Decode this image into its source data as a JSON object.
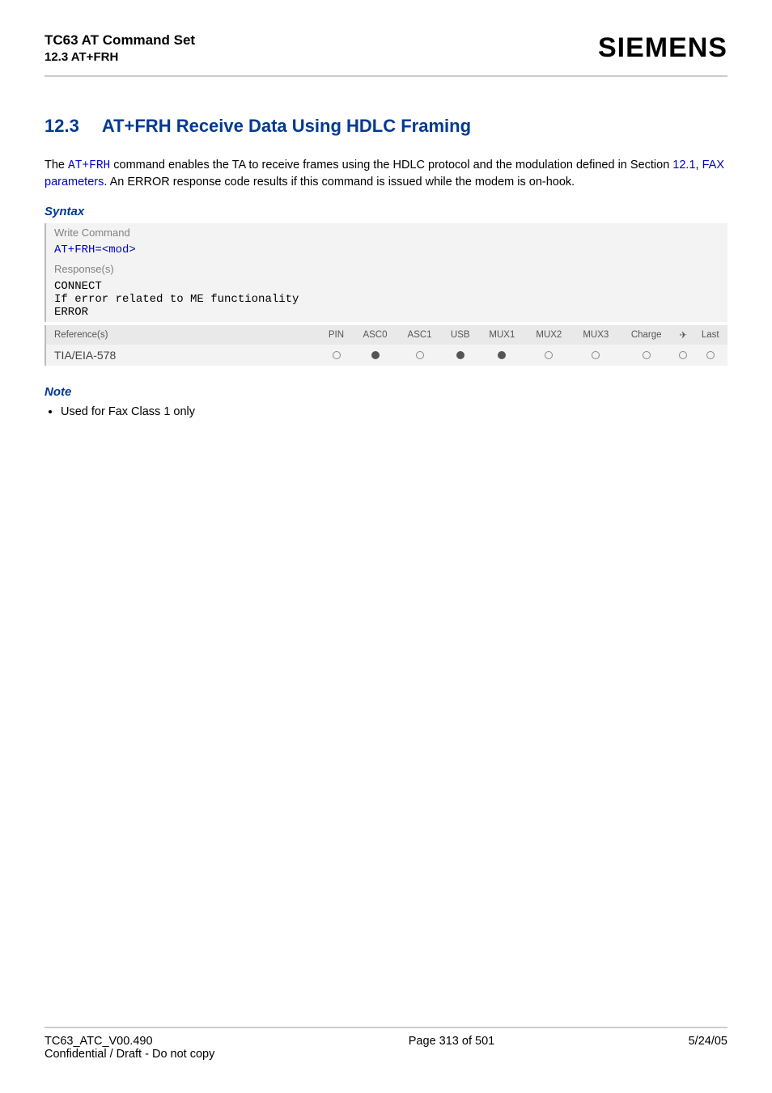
{
  "header": {
    "doc_title": "TC63 AT Command Set",
    "doc_section": "12.3 AT+FRH",
    "brand": "SIEMENS"
  },
  "section": {
    "number": "12.3",
    "title": "AT+FRH   Receive Data Using HDLC Framing"
  },
  "intro": {
    "pre_link1": "The ",
    "link1": "AT+FRH",
    "mid1": " command enables the TA to receive frames using the HDLC protocol and the modulation defined in Section ",
    "link2": "12.1",
    "mid2": ", ",
    "link3": "FAX parameters",
    "tail": ". An ERROR response code results if this command is issued while the modem is on-hook."
  },
  "syntax": {
    "label": "Syntax",
    "write_cmd_label": "Write Command",
    "write_cmd_pre": "AT+FRH=",
    "write_cmd_param": "<mod>",
    "responses_label": "Response(s)",
    "responses_lines": [
      "CONNECT",
      "If error related to ME functionality",
      "ERROR"
    ]
  },
  "ref_table": {
    "ref_label": "Reference(s)",
    "cols": [
      "PIN",
      "ASC0",
      "ASC1",
      "USB",
      "MUX1",
      "MUX2",
      "MUX3",
      "Charge",
      "✈",
      "Last"
    ],
    "ref_value": "TIA/EIA-578",
    "vals": [
      "empty",
      "filled",
      "empty",
      "filled",
      "filled",
      "empty",
      "empty",
      "empty",
      "empty",
      "empty"
    ]
  },
  "note": {
    "label": "Note",
    "items": [
      "Used for Fax Class 1 only"
    ]
  },
  "footer": {
    "version": "TC63_ATC_V00.490",
    "confidential": "Confidential / Draft - Do not copy",
    "page": "Page 313 of 501",
    "date": "5/24/05"
  }
}
